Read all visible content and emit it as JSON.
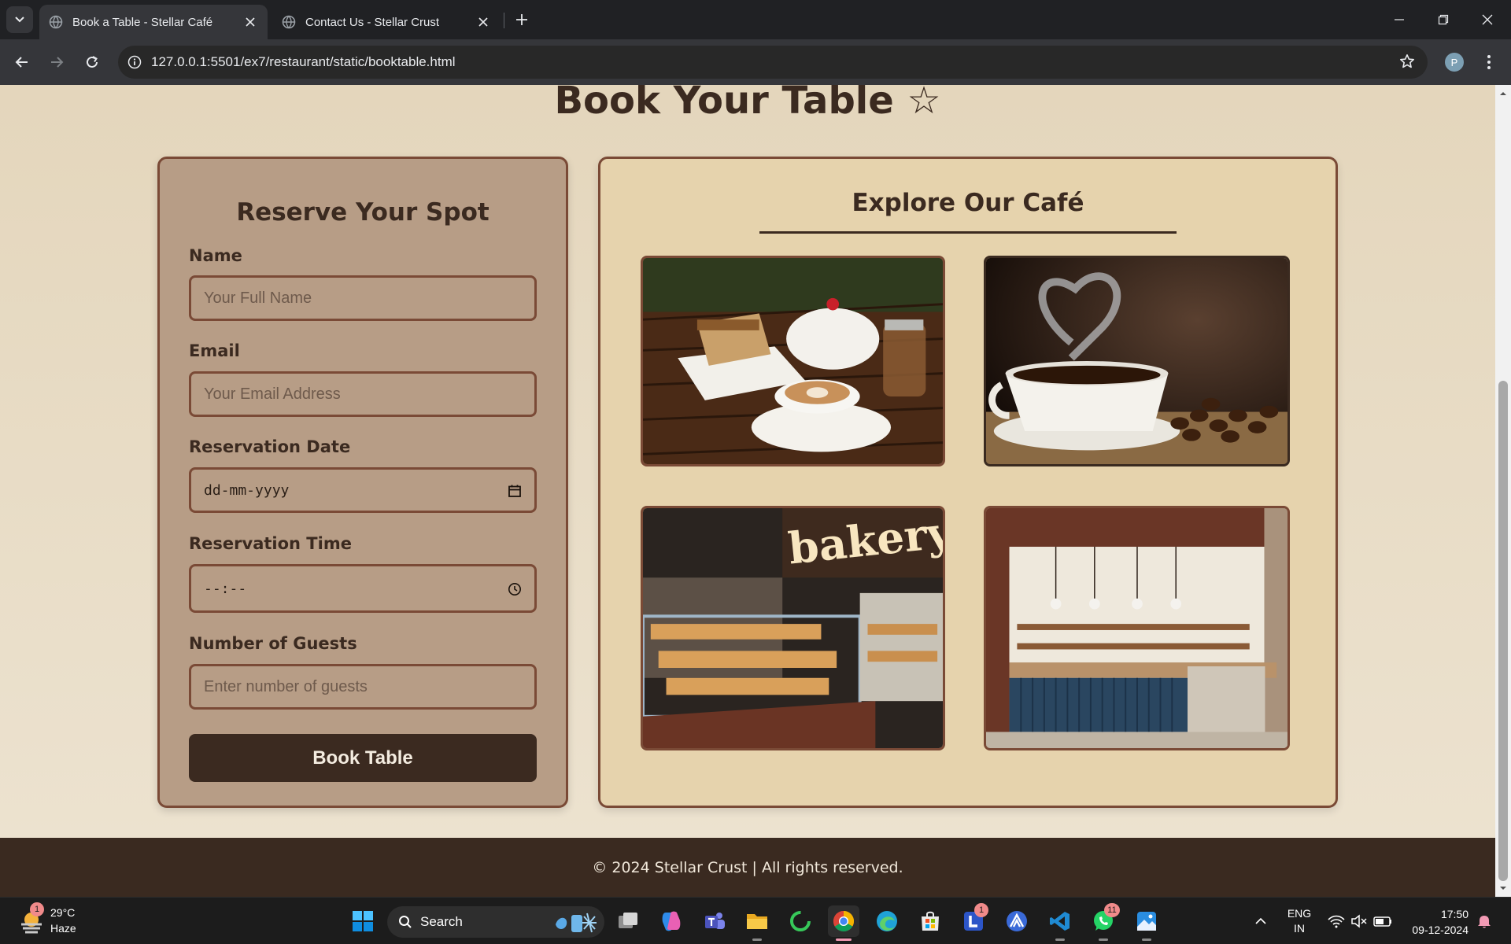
{
  "browser": {
    "tabs": [
      {
        "title": "Book a Table - Stellar Café",
        "active": true
      },
      {
        "title": "Contact Us - Stellar Crust",
        "active": false
      }
    ],
    "url": "127.0.0.1:5501/ex7/restaurant/static/booktable.html",
    "profile_initial": "P"
  },
  "page": {
    "title": "Book Your Table ☆",
    "form": {
      "title": "Reserve Your Spot",
      "fields": [
        {
          "label": "Name",
          "placeholder": "Your Full Name"
        },
        {
          "label": "Email",
          "placeholder": "Your Email Address"
        },
        {
          "label": "Reservation Date",
          "placeholder": "dd-mm-yyyy"
        },
        {
          "label": "Reservation Time",
          "placeholder": "--:--"
        },
        {
          "label": "Number of Guests",
          "placeholder": "Enter number of guests"
        }
      ],
      "submit_label": "Book Table"
    },
    "gallery": {
      "title": "Explore Our Café",
      "photos": [
        "cake-and-latte-photo",
        "coffee-heart-steam-photo",
        "bakery-counter-photo",
        "cafe-interior-photo"
      ],
      "bakery_sign": "bakery"
    },
    "footer": "© 2024 Stellar Crust | All rights reserved."
  },
  "taskbar": {
    "weather": {
      "temp": "29°C",
      "condition": "Haze",
      "badge": "1"
    },
    "search_label": "Search",
    "badges": {
      "l_app": "1",
      "whatsapp": "11"
    },
    "language": {
      "line1": "ENG",
      "line2": "IN"
    },
    "clock": {
      "time": "17:50",
      "date": "09-12-2024"
    }
  },
  "colors": {
    "page_bg": "#e4d6bc",
    "card_brown": "#b79d86",
    "gallery_bg": "#e6d3ad",
    "border_brown": "#7a4a36",
    "dark_brown": "#3b2a20"
  }
}
